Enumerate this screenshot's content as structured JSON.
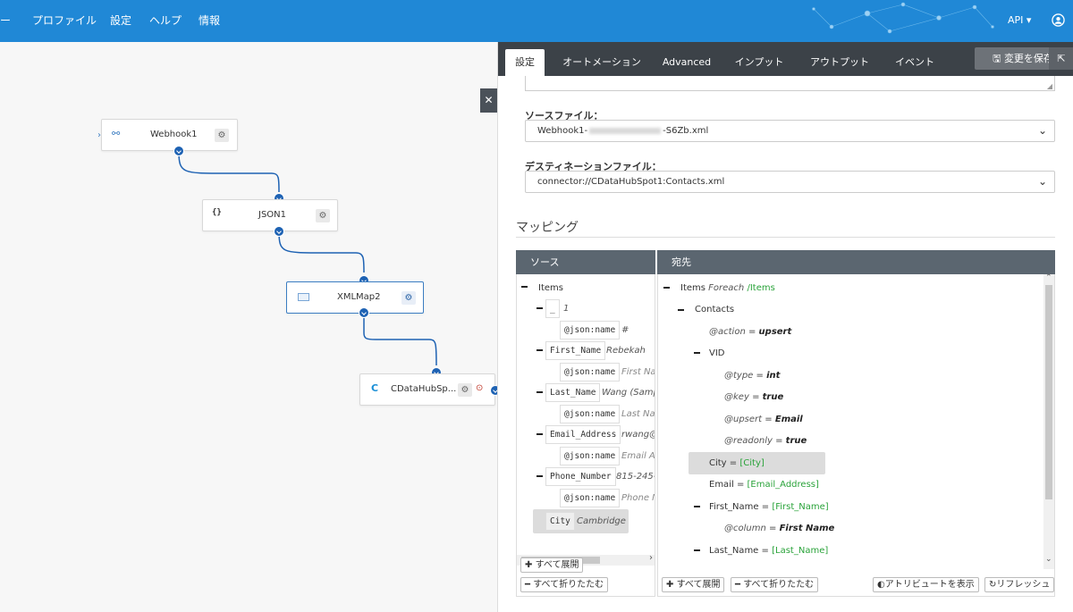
{
  "nav": {
    "items": [
      "ー",
      "プロファイル",
      "設定",
      "ヘルプ",
      "情報"
    ],
    "api_label": "API"
  },
  "flow": {
    "nodes": [
      {
        "label": "Webhook1",
        "icon": "webhook-icon"
      },
      {
        "label": "JSON1",
        "icon": "json-icon"
      },
      {
        "label": "XMLMap2",
        "icon": "xmlmap-icon"
      },
      {
        "label": "CDataHubSp...",
        "icon": "cdata-icon"
      }
    ]
  },
  "panel": {
    "tabs": [
      "設定",
      "オートメーション",
      "Advanced",
      "インプット",
      "アウトプット",
      "イベント"
    ],
    "active_tab": "設定",
    "save_label": "変更を保存",
    "source_file_label": "ソースファイル：",
    "source_file_prefix": "Webhook1-",
    "source_file_suffix": "-S6Zb.xml",
    "dest_file_label": "デスティネーションファイル：",
    "dest_file_value": "connector://CDataHubSpot1:Contacts.xml",
    "mapping_title": "マッピング",
    "source_header": "ソース",
    "dest_header": "宛先",
    "source_tree": {
      "root": "Items",
      "index": "1",
      "index_key": "_",
      "json_name": "@json:name",
      "hash": "#",
      "fields": [
        {
          "name": "First_Name",
          "value": "Rebekah",
          "attr": "First Na"
        },
        {
          "name": "Last_Name",
          "value": "Wang (Samp",
          "attr": "Last Na"
        },
        {
          "name": "Email_Address",
          "value": "rwang@",
          "attr": "Email A"
        },
        {
          "name": "Phone_Number",
          "value": "815-245-",
          "attr": "Phone N"
        }
      ],
      "city_name": "City",
      "city_value": "Cambridge"
    },
    "dest_tree": {
      "items": "Items",
      "items_foreach": "Foreach",
      "items_path": "/Items",
      "contacts": "Contacts",
      "action_attr": "@action",
      "action_val": "upsert",
      "vid": "VID",
      "type_attr": "@type",
      "type_val": "int",
      "key_attr": "@key",
      "key_val": "true",
      "upsert_attr": "@upsert",
      "upsert_val": "Email",
      "readonly_attr": "@readonly",
      "readonly_val": "true",
      "city": "City",
      "city_map": "[City]",
      "email": "Email",
      "email_map": "[Email_Address]",
      "first": "First_Name",
      "first_map": "[First_Name]",
      "column_attr": "@column",
      "column_val": "First Name",
      "last": "Last_Name",
      "last_map": "[Last_Name]",
      "eq": "="
    },
    "src_expand": "すべて展開",
    "src_collapse": "すべて折りたたむ",
    "dst_expand": "すべて展開",
    "dst_collapse": "すべて折りたたむ",
    "show_attrs": "アトリビュートを表示",
    "refresh": "リフレッシュ"
  }
}
